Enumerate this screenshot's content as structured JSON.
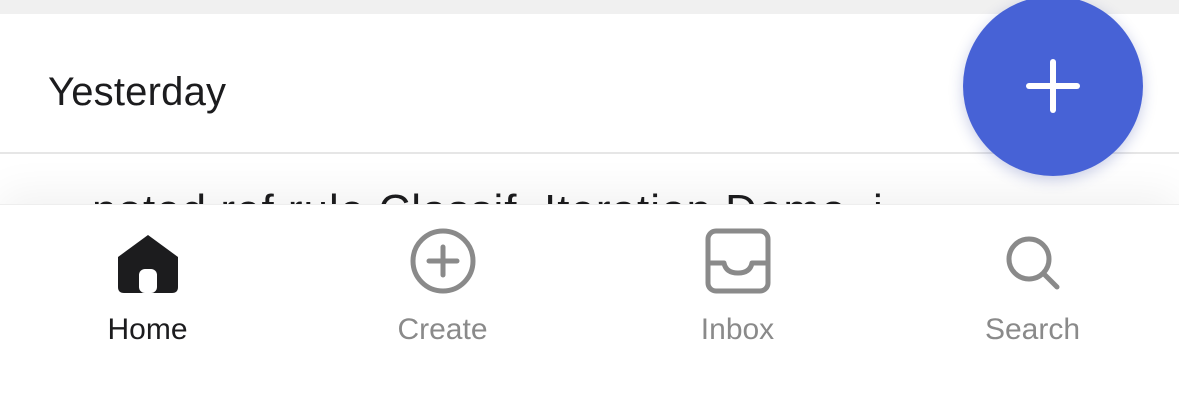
{
  "section": {
    "title": "Yesterday"
  },
  "peek_row": {
    "text": "noted ref rule  Classif..Iteration  Demo..i"
  },
  "fab": {
    "icon": "plus-icon",
    "color": "#4762d6"
  },
  "tab_bar": {
    "active_color": "#1c1c1e",
    "inactive_color": "#8a8a8a",
    "tabs": [
      {
        "label": "Home",
        "icon": "home-icon",
        "active": true
      },
      {
        "label": "Create",
        "icon": "plus-circle-icon",
        "active": false
      },
      {
        "label": "Inbox",
        "icon": "inbox-icon",
        "active": false
      },
      {
        "label": "Search",
        "icon": "search-icon",
        "active": false
      }
    ]
  }
}
